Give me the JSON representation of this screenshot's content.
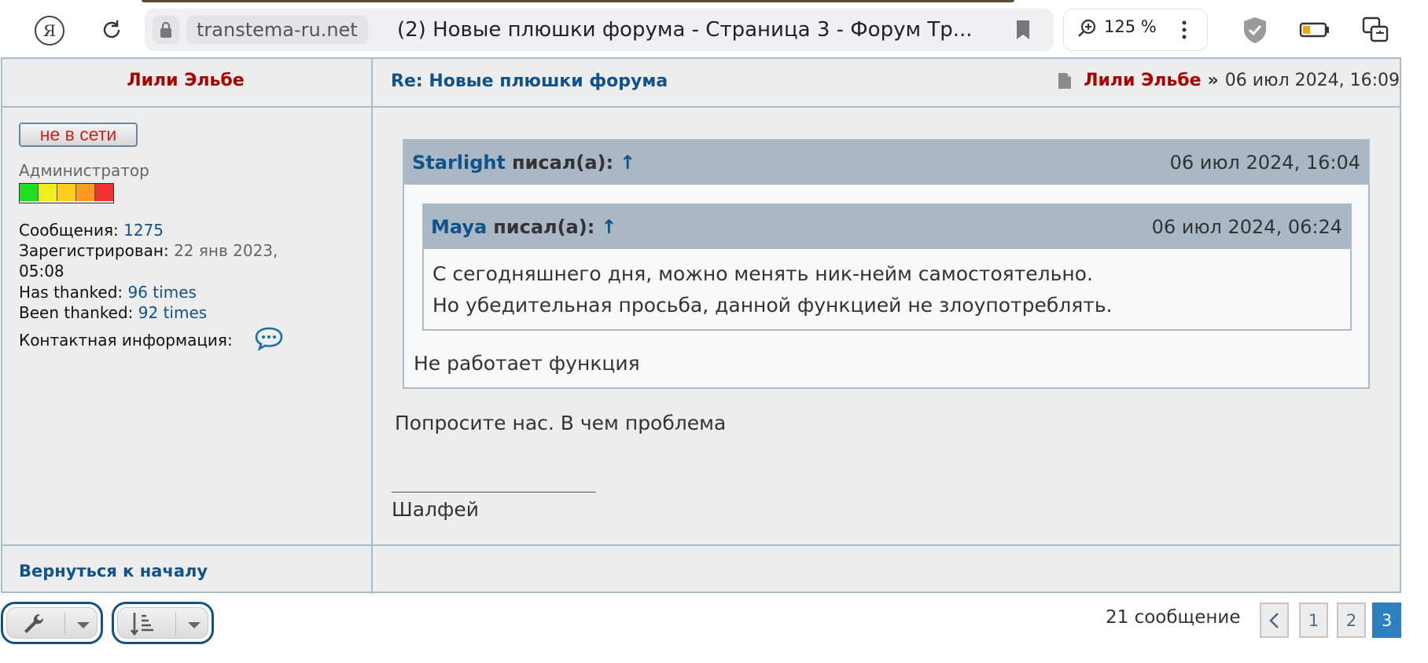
{
  "browser": {
    "domain": "transtema-ru.net",
    "tab_title": "(2) Новые плюшки форума - Страница 3 - Форум Тр...",
    "zoom": "125 %",
    "yandex_glyph": "Я"
  },
  "post": {
    "author": "Лили Эльбе",
    "title": "Re: Новые плюшки форума",
    "meta_author": "Лили Эльбе",
    "meta_sep": "»",
    "meta_date": "06 июл 2024, 16:09",
    "status": "не в сети",
    "rank": "Администратор",
    "rank_colors": [
      "#22dd22",
      "#eeee22",
      "#ffcc22",
      "#ff9922",
      "#ee3333"
    ],
    "profile": {
      "messages_label": "Сообщения:",
      "messages": "1275",
      "registered_label": "Зарегистрирован:",
      "registered_line1": "22 янв 2023,",
      "registered_line2": "05:08",
      "thanked_label": "Has thanked:",
      "thanked": "96 times",
      "been_thanked_label": "Been thanked:",
      "been_thanked": "92 times",
      "contact_label": "Контактная информация:"
    },
    "outer_quote": {
      "author": "Starlight",
      "wrote": "писал(а):",
      "arrow": "↑",
      "date": "06 июл 2024, 16:04",
      "text": "Не работает функция"
    },
    "inner_quote": {
      "author": "Maya",
      "wrote": "писал(а):",
      "arrow": "↑",
      "date": "06 июл 2024, 06:24",
      "line1": "С сегодняшнего дня, можно менять ник-нейм самостоятельно.",
      "line2": "Но убедительная просьба, данной функцией не злоупотреблять."
    },
    "body": "Попросите нас. В чем проблема",
    "signature": "Шалфей",
    "back_to_top": "Вернуться к началу"
  },
  "pagination": {
    "count": "21 сообщение",
    "pages": [
      "1",
      "2",
      "3"
    ],
    "current": "3"
  },
  "colors": {
    "link": "#105289",
    "author": "#aa0000",
    "border": "#a9bccc",
    "active_page": "#2d7fbd"
  }
}
